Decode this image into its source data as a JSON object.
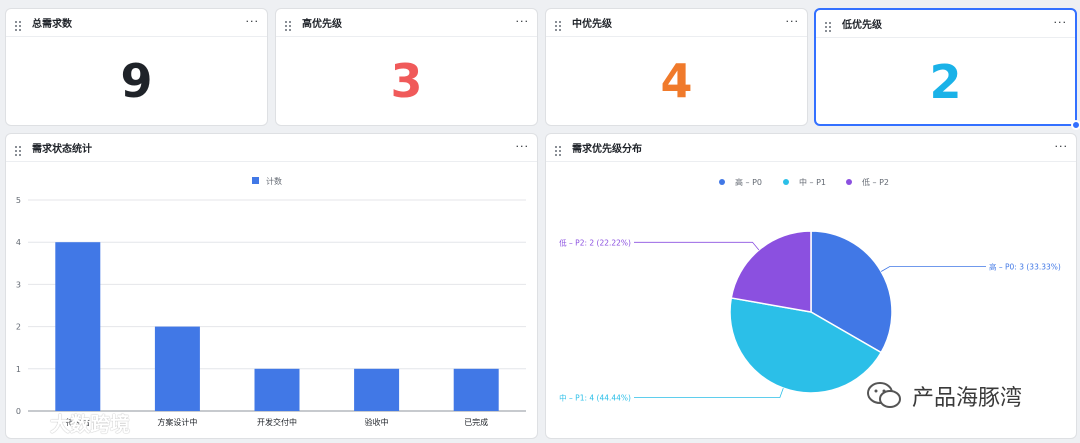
{
  "stat_cards": [
    {
      "title": "总需求数",
      "value": "9",
      "color": "#1f2329"
    },
    {
      "title": "高优先级",
      "value": "3",
      "color": "#f05a5a"
    },
    {
      "title": "中优先级",
      "value": "4",
      "color": "#f07a2b"
    },
    {
      "title": "低优先级",
      "value": "2",
      "color": "#1ab2e8"
    }
  ],
  "bar_panel": {
    "title": "需求状态统计"
  },
  "pie_panel": {
    "title": "需求优先级分布"
  },
  "more_label": "···",
  "chart_data": [
    {
      "type": "bar",
      "legend": [
        "计数"
      ],
      "legend_position": "top-center",
      "categories": [
        "待评估",
        "方案设计中",
        "开发交付中",
        "验收中",
        "已完成"
      ],
      "series": [
        {
          "name": "计数",
          "values": [
            4,
            2,
            1,
            1,
            1
          ],
          "color": "#4178e6"
        }
      ],
      "ylim": [
        0,
        5
      ],
      "yticks": [
        "0",
        "1",
        "2",
        "3",
        "4",
        "5"
      ],
      "grid": true
    },
    {
      "type": "pie",
      "legend_position": "top-center",
      "slices": [
        {
          "name": "高 – P0",
          "value": 3,
          "percent": "33.33%",
          "label": "高 – P0: 3 (33.33%)",
          "color": "#4178e6"
        },
        {
          "name": "中 – P1",
          "value": 4,
          "percent": "44.44%",
          "label": "中 – P1: 4 (44.44%)",
          "color": "#2bbfe8"
        },
        {
          "name": "低 – P2",
          "value": 2,
          "percent": "22.22%",
          "label": "低 – P2: 2 (22.22%)",
          "color": "#8b50e0"
        }
      ]
    }
  ],
  "watermarks": {
    "left": "大数跨境",
    "right": "产品海豚湾"
  }
}
